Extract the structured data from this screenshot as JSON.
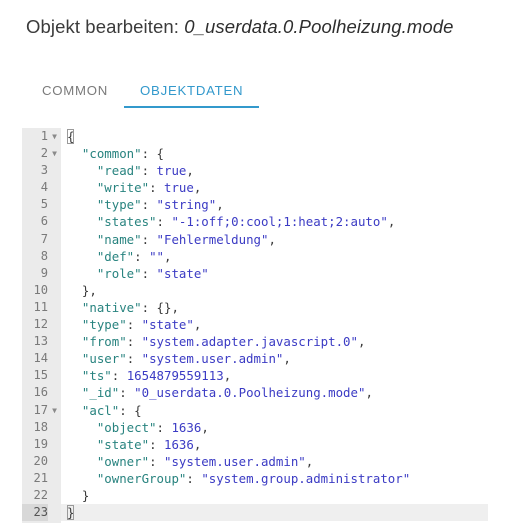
{
  "dialog": {
    "title_prefix": "Objekt bearbeiten:",
    "object_id": "0_userdata.0.Poolheizung.mode"
  },
  "tabs": [
    {
      "label": "COMMON",
      "active": false
    },
    {
      "label": "OBJEKTDATEN",
      "active": true
    }
  ],
  "colors": {
    "accent": "#3399cc",
    "tab_inactive": "#7b7b7b",
    "gutter_bg": "#ebebeb",
    "active_line_bg": "#efefef",
    "json_key": "#28837f",
    "json_value": "#3b3bc4"
  },
  "editor": {
    "total_lines": 23,
    "active_line": 23,
    "fold_lines": [
      1,
      2,
      17
    ],
    "lines": [
      {
        "n": 1,
        "text": "{"
      },
      {
        "n": 2,
        "text": "  \"common\": {"
      },
      {
        "n": 3,
        "text": "    \"read\": true,"
      },
      {
        "n": 4,
        "text": "    \"write\": true,"
      },
      {
        "n": 5,
        "text": "    \"type\": \"string\","
      },
      {
        "n": 6,
        "text": "    \"states\": \"-1:off;0:cool;1:heat;2:auto\","
      },
      {
        "n": 7,
        "text": "    \"name\": \"Fehlermeldung\","
      },
      {
        "n": 8,
        "text": "    \"def\": \"\","
      },
      {
        "n": 9,
        "text": "    \"role\": \"state\""
      },
      {
        "n": 10,
        "text": "  },"
      },
      {
        "n": 11,
        "text": "  \"native\": {},"
      },
      {
        "n": 12,
        "text": "  \"type\": \"state\","
      },
      {
        "n": 13,
        "text": "  \"from\": \"system.adapter.javascript.0\","
      },
      {
        "n": 14,
        "text": "  \"user\": \"system.user.admin\","
      },
      {
        "n": 15,
        "text": "  \"ts\": 1654879559113,"
      },
      {
        "n": 16,
        "text": "  \"_id\": \"0_userdata.0.Poolheizung.mode\","
      },
      {
        "n": 17,
        "text": "  \"acl\": {"
      },
      {
        "n": 18,
        "text": "    \"object\": 1636,"
      },
      {
        "n": 19,
        "text": "    \"state\": 1636,"
      },
      {
        "n": 20,
        "text": "    \"owner\": \"system.user.admin\","
      },
      {
        "n": 21,
        "text": "    \"ownerGroup\": \"system.group.administrator\""
      },
      {
        "n": 22,
        "text": "  }"
      },
      {
        "n": 23,
        "text": "}"
      }
    ]
  }
}
